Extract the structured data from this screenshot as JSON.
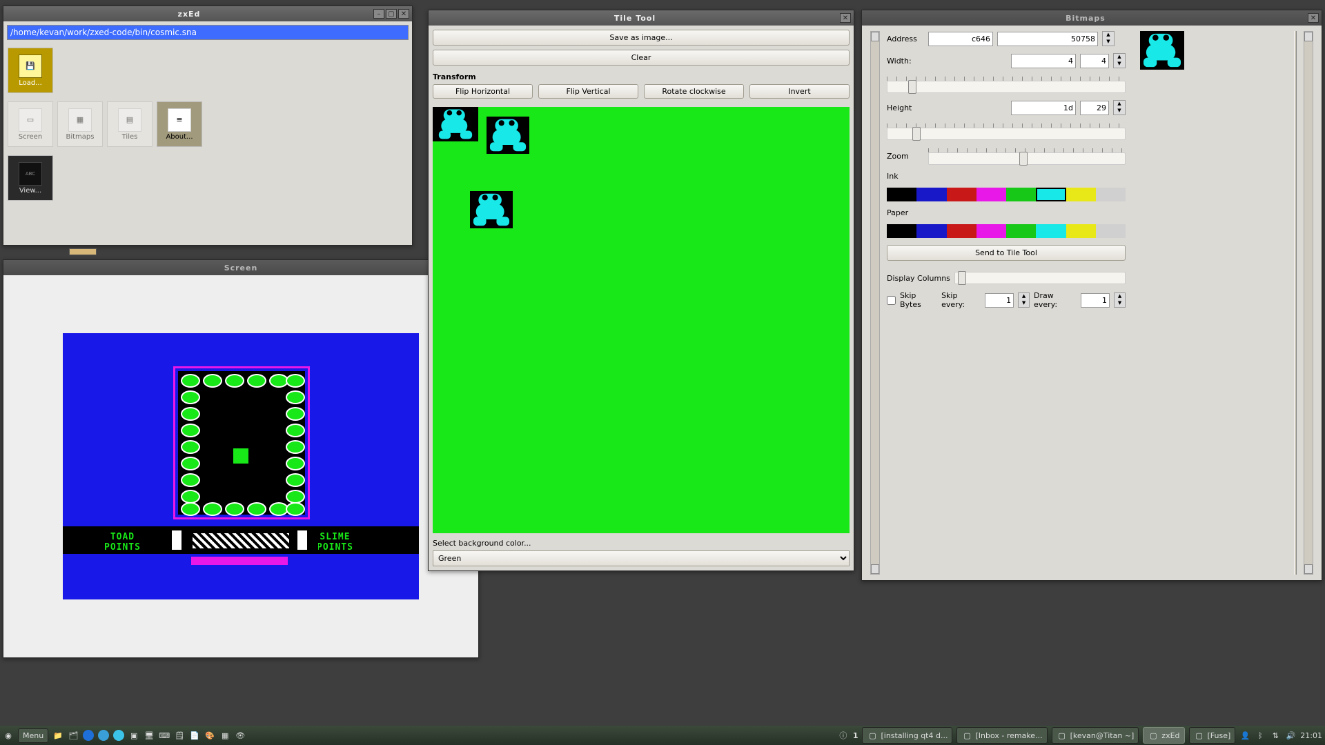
{
  "windows": {
    "main": {
      "title": "zxEd",
      "path": "/home/kevan/work/zxed-code/bin/cosmic.sna"
    },
    "screen": {
      "title": "Screen",
      "hud": {
        "left": "TOAD\nPOINTS",
        "right": "SLIME\nPOINTS"
      }
    },
    "tile": {
      "title": "Tile Tool",
      "save": "Save as image...",
      "clear": "Clear",
      "transform_label": "Transform",
      "flip_h": "Flip Horizontal",
      "flip_v": "Flip Vertical",
      "rotate": "Rotate clockwise",
      "invert": "Invert",
      "bg_label": "Select background color...",
      "bg_value": "Green"
    },
    "bitmaps": {
      "title": "Bitmaps"
    }
  },
  "tools": {
    "load": "Load...",
    "screen": "Screen",
    "bitmaps": "Bitmaps",
    "tiles": "Tiles",
    "about": "About...",
    "view": "View..."
  },
  "bitmaps": {
    "address_label": "Address",
    "address_hex": "c646",
    "address_dec": "50758",
    "width_label": "Width:",
    "width_hex": "4",
    "width_dec": "4",
    "height_label": "Height",
    "height_hex": "1d",
    "height_dec": "29",
    "zoom_label": "Zoom",
    "ink_label": "Ink",
    "paper_label": "Paper",
    "send_btn": "Send to Tile Tool",
    "disp_cols_label": "Display Columns",
    "skip_bytes_label": "Skip Bytes",
    "skip_every_label": "Skip every:",
    "skip_every_val": "1",
    "draw_every_label": "Draw every:",
    "draw_every_val": "1",
    "ink_selected": "cyan",
    "paper_selected": "black"
  },
  "palette": [
    {
      "name": "black",
      "hex": "#000000"
    },
    {
      "name": "blue",
      "hex": "#1818c8"
    },
    {
      "name": "red",
      "hex": "#c81818"
    },
    {
      "name": "magenta",
      "hex": "#e818e8"
    },
    {
      "name": "green",
      "hex": "#18c818"
    },
    {
      "name": "cyan",
      "hex": "#18e8e8"
    },
    {
      "name": "yellow",
      "hex": "#e8e818"
    },
    {
      "name": "white",
      "hex": "#d0d0d0"
    }
  ],
  "taskbar": {
    "menu": "Menu",
    "workspace_badge": "1",
    "items": [
      {
        "label": "[installing qt4 d...",
        "active": false
      },
      {
        "label": "[Inbox - remake...",
        "active": false
      },
      {
        "label": "[kevan@Titan ~]",
        "active": false
      },
      {
        "label": "zxEd",
        "active": true
      },
      {
        "label": "[Fuse]",
        "active": false
      }
    ],
    "clock": "21:01"
  }
}
